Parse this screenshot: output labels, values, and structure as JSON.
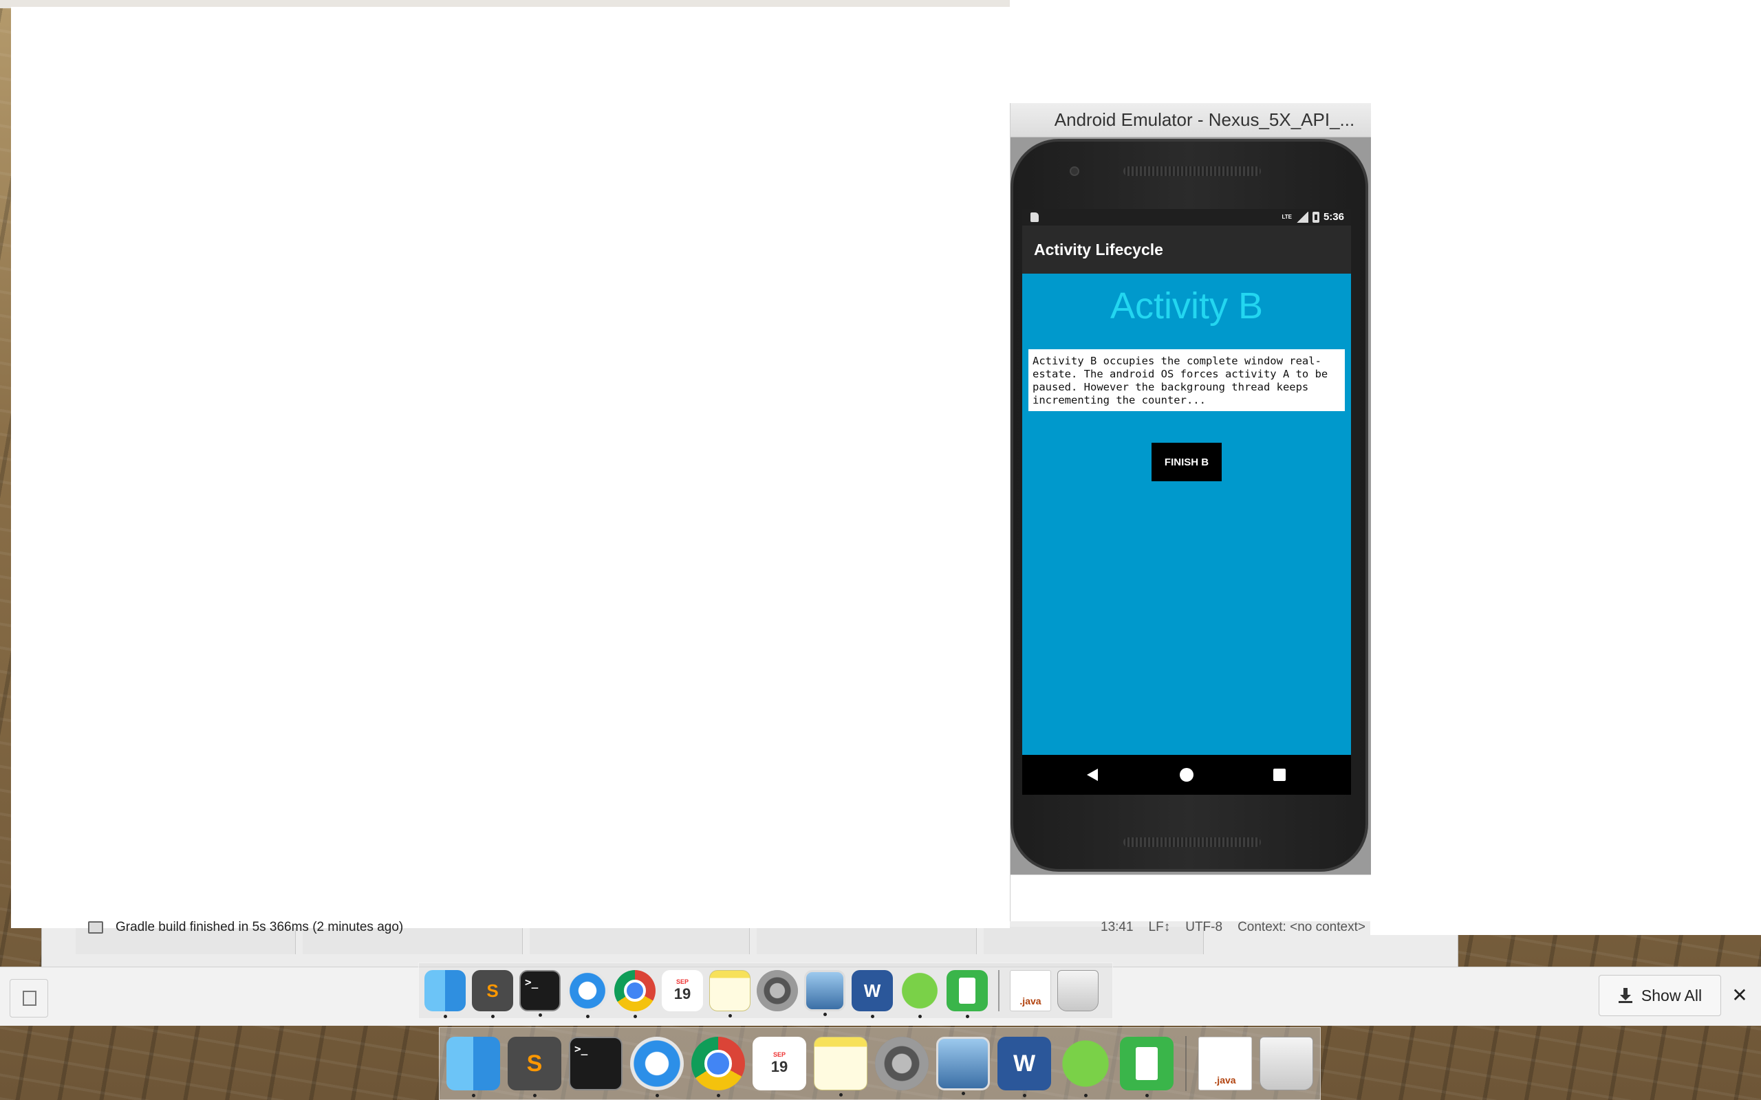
{
  "emulator": {
    "window_title": "Android Emulator - Nexus_5X_API_...",
    "status_bar": {
      "time": "5:36",
      "network": "LTE"
    },
    "app": {
      "title": "Activity Lifecycle",
      "heading": "Activity B",
      "description": "Activity B occupies the complete window real-estate. The android OS forces activity A to be paused. However the backgroung thread keeps incrementing the counter...",
      "finish_button_label": "FINISH B"
    },
    "nav": {
      "back": "back-icon",
      "home": "home-icon",
      "recents": "recents-icon"
    },
    "colors": {
      "screen_bg": "#0099cc",
      "heading": "#23d6f0",
      "app_bar": "#2a2a2a"
    }
  },
  "ide": {
    "build_status": "Gradle build finished in 5s 366ms (2 minutes ago)",
    "statusline": {
      "position": "13:41",
      "line_sep": "LF↕",
      "encoding": "UTF-8",
      "context": "Context: <no context>"
    }
  },
  "downloads": {
    "show_all_label": "Show All",
    "close_label": "✕"
  },
  "dock": {
    "upper_icons": [
      "finder-icon",
      "sublime-icon",
      "terminal-icon",
      "safari-icon",
      "chrome-icon",
      "calendar-icon",
      "notes-icon",
      "system-preferences-icon",
      "preview-icon",
      "word-icon",
      "android-studio-icon",
      "phone-app-icon",
      "java-file-icon",
      "trash-icon"
    ],
    "lower_icons": [
      "finder-icon",
      "sublime-icon",
      "terminal-icon",
      "safari-icon",
      "chrome-icon",
      "calendar-icon",
      "notes-icon",
      "system-preferences-icon",
      "preview-icon",
      "word-icon",
      "android-studio-icon",
      "phone-app-icon",
      "java-file-icon",
      "trash-icon"
    ],
    "calendar_month": "SEP",
    "calendar_day": "19",
    "java_label": ".java",
    "terminal_prompt": ">_",
    "sublime_letter": "S",
    "word_letter": "W"
  }
}
